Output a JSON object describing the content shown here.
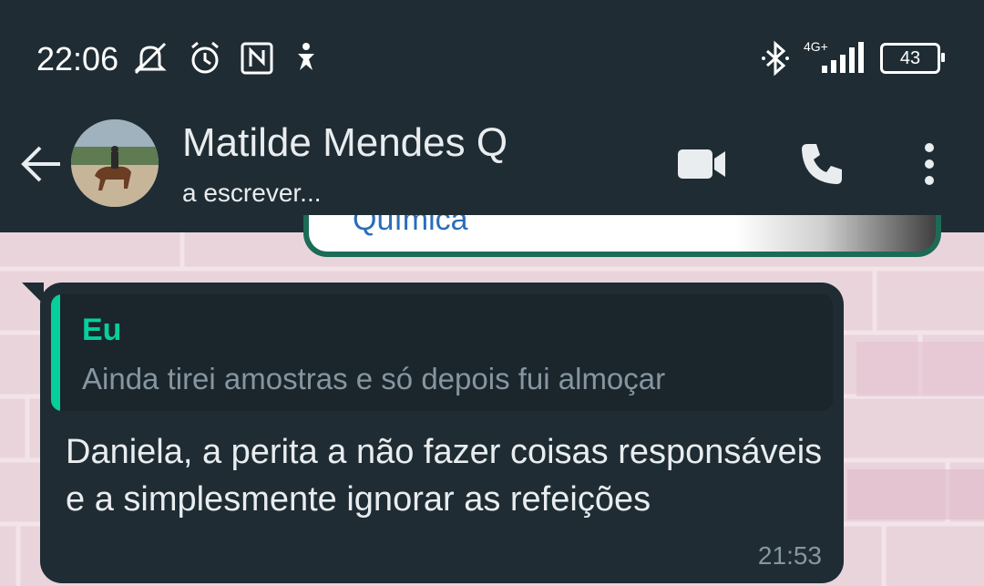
{
  "status_bar": {
    "time": "22:06",
    "network": "4G+",
    "battery": "43",
    "icons": [
      "mute-icon",
      "alarm-icon",
      "nfc-icon",
      "accessibility-icon",
      "bluetooth-icon",
      "signal-icon",
      "battery-icon"
    ]
  },
  "header": {
    "contact_name": "Matilde Mendes Q",
    "status": "a escrever...",
    "icons": [
      "back-arrow-icon",
      "video-call-icon",
      "voice-call-icon",
      "more-options-icon"
    ]
  },
  "previous_message": {
    "text": "Química"
  },
  "message": {
    "quoted_author": "Eu",
    "quoted_text": "Ainda tirei amostras e só depois fui almoçar",
    "text": "Daniela, a perita a não fazer coisas responsáveis e a simplesmente ignorar as refeições",
    "time": "21:53"
  },
  "colors": {
    "header_bg": "#1f2c34",
    "bubble_bg": "#1f2c34",
    "accent": "#06cf9c",
    "chat_wallpaper": "#ead4db"
  }
}
